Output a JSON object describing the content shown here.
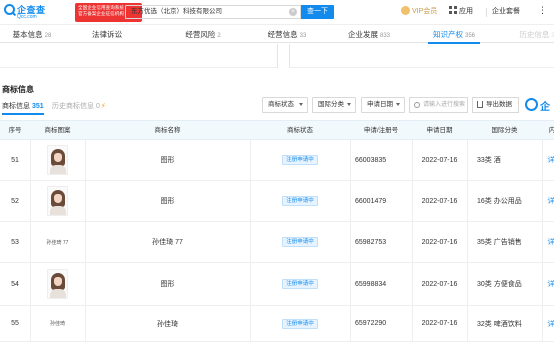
{
  "header": {
    "logo_text": "企查查",
    "logo_sub": "Qcc.com",
    "promo_lines": [
      "全国企业信用查询系统",
      "官方备案企业征信机构"
    ],
    "search_value": "东方优选（北京）科技有限公司",
    "search_button": "查一下",
    "vip_label": "VIP会员",
    "app_label": "应用",
    "suite_label": "企业套餐"
  },
  "tabs": [
    {
      "label": "基本信息",
      "count": "28"
    },
    {
      "label": "法律诉讼",
      "count": ""
    },
    {
      "label": "经营风险",
      "count": "2"
    },
    {
      "label": "经营信息",
      "count": "33"
    },
    {
      "label": "企业发展",
      "count": "833"
    },
    {
      "label": "知识产权",
      "count": "356"
    },
    {
      "label": "历史信息",
      "count": "3"
    }
  ],
  "section": {
    "title": "商标信息",
    "subtab_active_label": "商标信息",
    "subtab_active_count": "351",
    "subtab_history_label": "历史商标信息 0"
  },
  "filters": {
    "status": "商标状态",
    "category": "国际分类",
    "date": "申请日期",
    "search_placeholder": "请输入进行搜索",
    "export": "导出数据",
    "brand": "企"
  },
  "table": {
    "headers": [
      "序号",
      "商标图案",
      "商标名称",
      "商标状态",
      "申请/注册号",
      "申请日期",
      "国际分类",
      "内"
    ],
    "rows": [
      {
        "idx": "51",
        "image": "photo",
        "image_text": "",
        "name": "图形",
        "status": "注册申请中",
        "reg_no": "66003835",
        "date": "2022-07-16",
        "class": "33类 酒",
        "detail": "详"
      },
      {
        "idx": "52",
        "image": "photo",
        "image_text": "",
        "name": "图形",
        "status": "注册申请中",
        "reg_no": "66001479",
        "date": "2022-07-16",
        "class": "16类 办公用品",
        "detail": "详"
      },
      {
        "idx": "53",
        "image": "text",
        "image_text": "孙佳琦 77",
        "name": "孙佳琦 77",
        "status": "注册申请中",
        "reg_no": "65982753",
        "date": "2022-07-16",
        "class": "35类 广告销售",
        "detail": "详"
      },
      {
        "idx": "54",
        "image": "photo",
        "image_text": "",
        "name": "图形",
        "status": "注册申请中",
        "reg_no": "65998834",
        "date": "2022-07-16",
        "class": "30类 方便食品",
        "detail": "详"
      },
      {
        "idx": "55",
        "image": "text",
        "image_text": "孙佳琦",
        "name": "孙佳琦",
        "status": "注册申请中",
        "reg_no": "65972290",
        "date": "2022-07-16",
        "class": "32类 啤酒饮料",
        "detail": "详"
      }
    ]
  },
  "colors": {
    "accent": "#128bed",
    "promo": "#e33333",
    "vip": "#c79a4a"
  }
}
